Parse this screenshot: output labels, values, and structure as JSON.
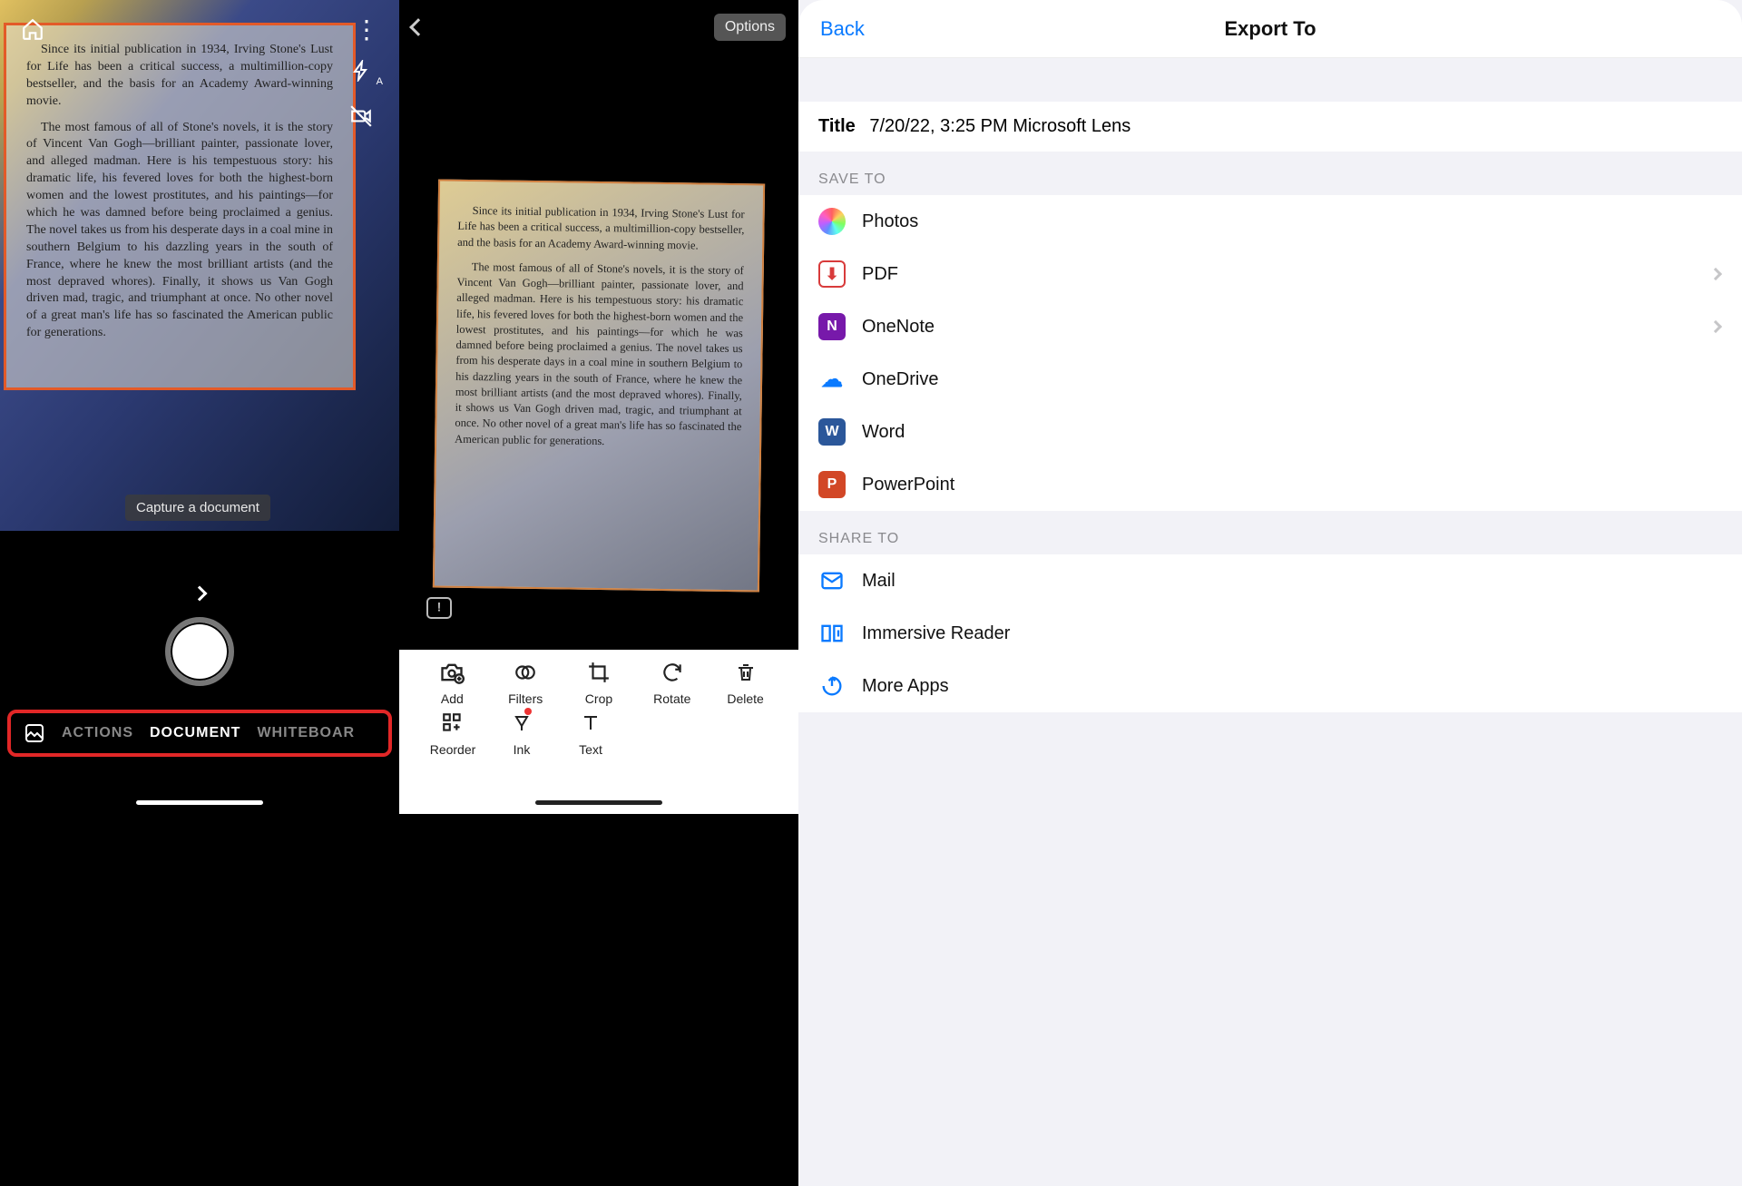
{
  "panel1": {
    "hint": "Capture a document",
    "para1": "Since its initial publication in 1934, Irving Stone's Lust for Life has been a critical success, a multimillion-copy bestseller, and the basis for an Academy Award-winning movie.",
    "para2": "The most famous of all of Stone's novels, it is the story of Vincent Van Gogh—brilliant painter, passionate lover, and alleged madman. Here is his tempestuous story: his dramatic life, his fevered loves for both the highest-born women and the lowest prostitutes, and his paintings—for which he was damned before being proclaimed a genius. The novel takes us from his desperate days in a coal mine in southern Belgium to his dazzling years in the south of France, where he knew the most brilliant artists (and the most depraved whores). Finally, it shows us Van Gogh driven mad, tragic, and triumphant at once. No other novel of a great man's life has so fascinated the American public for generations.",
    "modes": {
      "gallery": "",
      "actions": "ACTIONS",
      "document": "DOCUMENT",
      "whiteboard": "WHITEBOAR"
    }
  },
  "panel2": {
    "options": "Options",
    "para1": "Since its initial publication in 1934, Irving Stone's Lust for Life has been a critical success, a multimillion-copy bestseller, and the basis for an Academy Award-winning movie.",
    "para2": "The most famous of all of Stone's novels, it is the story of Vincent Van Gogh—brilliant painter, passionate lover, and alleged madman. Here is his tempestuous story: his dramatic life, his fevered loves for both the highest-born women and the lowest prostitutes, and his paintings—for which he was damned before being proclaimed a genius. The novel takes us from his desperate days in a coal mine in southern Belgium to his dazzling years in the south of France, where he knew the most brilliant artists (and the most depraved whores). Finally, it shows us Van Gogh driven mad, tragic, and triumphant at once. No other novel of a great man's life has so fascinated the American public for generations.",
    "tools": {
      "add": "Add",
      "filters": "Filters",
      "crop": "Crop",
      "rotate": "Rotate",
      "delete": "Delete",
      "reorder": "Reorder",
      "ink": "Ink",
      "text": "Text"
    }
  },
  "panel3": {
    "back": "Back",
    "header": "Export To",
    "title_label": "Title",
    "title_value": "7/20/22, 3:25 PM Microsoft Lens",
    "save_hdr": "SAVE TO",
    "share_hdr": "SHARE TO",
    "save": {
      "photos": "Photos",
      "pdf": "PDF",
      "onenote": "OneNote",
      "onedrive": "OneDrive",
      "word": "Word",
      "powerpoint": "PowerPoint"
    },
    "share": {
      "mail": "Mail",
      "immersive": "Immersive Reader",
      "more": "More Apps"
    }
  }
}
